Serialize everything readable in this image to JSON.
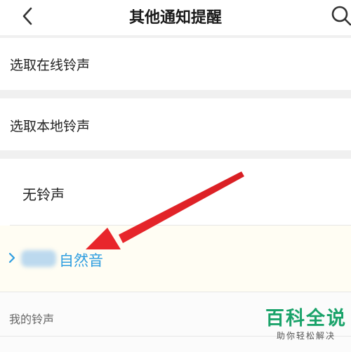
{
  "header": {
    "title": "其他通知提醒",
    "back_icon": "chevron-left-icon",
    "search_icon": "search-icon"
  },
  "options": {
    "online": "选取在线铃声",
    "local": "选取本地铃声"
  },
  "ringtones": {
    "none": "无铃声",
    "selected": "自然音",
    "mine_header": "我的铃声"
  },
  "watermark": {
    "main": "百科全说",
    "sub": "助你轻松解决"
  },
  "colors": {
    "accent": "#2f9ee0",
    "arrow": "#e8262b",
    "brand": "#1aa36a"
  }
}
